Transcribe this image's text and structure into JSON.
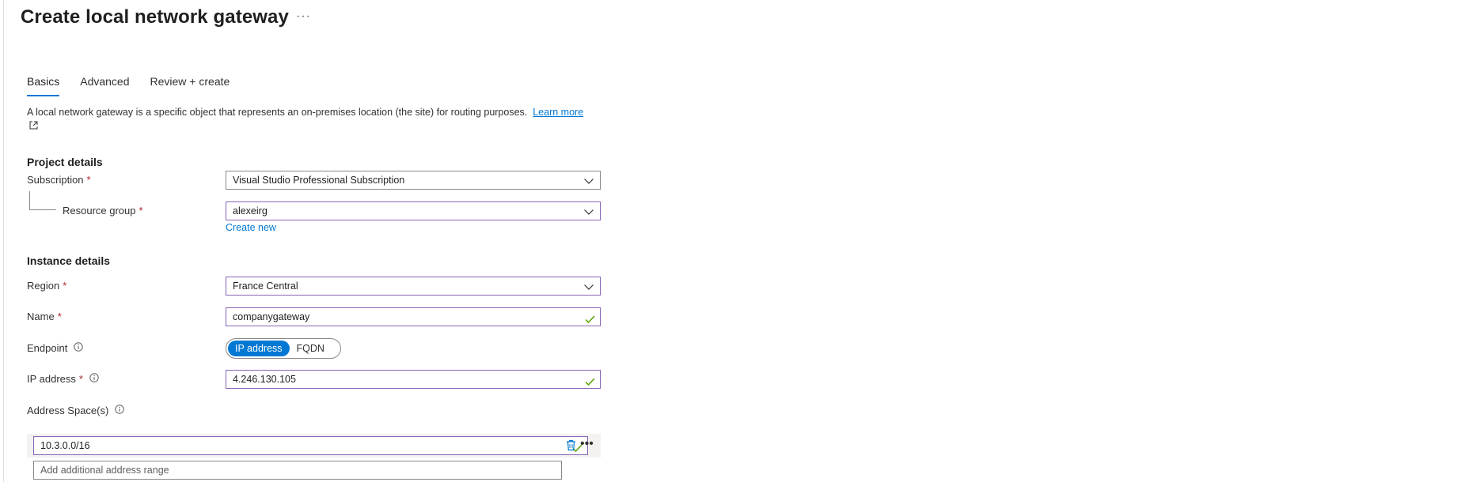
{
  "header": {
    "title": "Create local network gateway",
    "more_label": "···"
  },
  "tabs": [
    {
      "label": "Basics",
      "active": true
    },
    {
      "label": "Advanced",
      "active": false
    },
    {
      "label": "Review + create",
      "active": false
    }
  ],
  "description": {
    "text": "A local network gateway is a specific object that represents an on-premises location (the site) for routing purposes.",
    "link_label": "Learn more"
  },
  "project_details": {
    "heading": "Project details",
    "subscription": {
      "label": "Subscription",
      "required_mark": "*",
      "value": "Visual Studio Professional Subscription"
    },
    "resource_group": {
      "label": "Resource group",
      "required_mark": "*",
      "value": "alexeirg",
      "create_new_label": "Create new"
    }
  },
  "instance_details": {
    "heading": "Instance details",
    "region": {
      "label": "Region",
      "required_mark": "*",
      "value": "France Central"
    },
    "name": {
      "label": "Name",
      "required_mark": "*",
      "value": "companygateway"
    },
    "endpoint": {
      "label": "Endpoint",
      "options": [
        "IP address",
        "FQDN"
      ],
      "selected": "IP address"
    },
    "ip_address": {
      "label": "IP address",
      "required_mark": "*",
      "value": "4.246.130.105"
    },
    "address_spaces": {
      "label": "Address Space(s)",
      "entries": [
        "10.3.0.0/16"
      ],
      "more_label": "•••",
      "add_placeholder": "Add additional address range"
    }
  },
  "colors": {
    "accent": "#0078d4",
    "focus_border": "#8764b8",
    "required": "#a4262c",
    "valid_check": "#57a300"
  }
}
